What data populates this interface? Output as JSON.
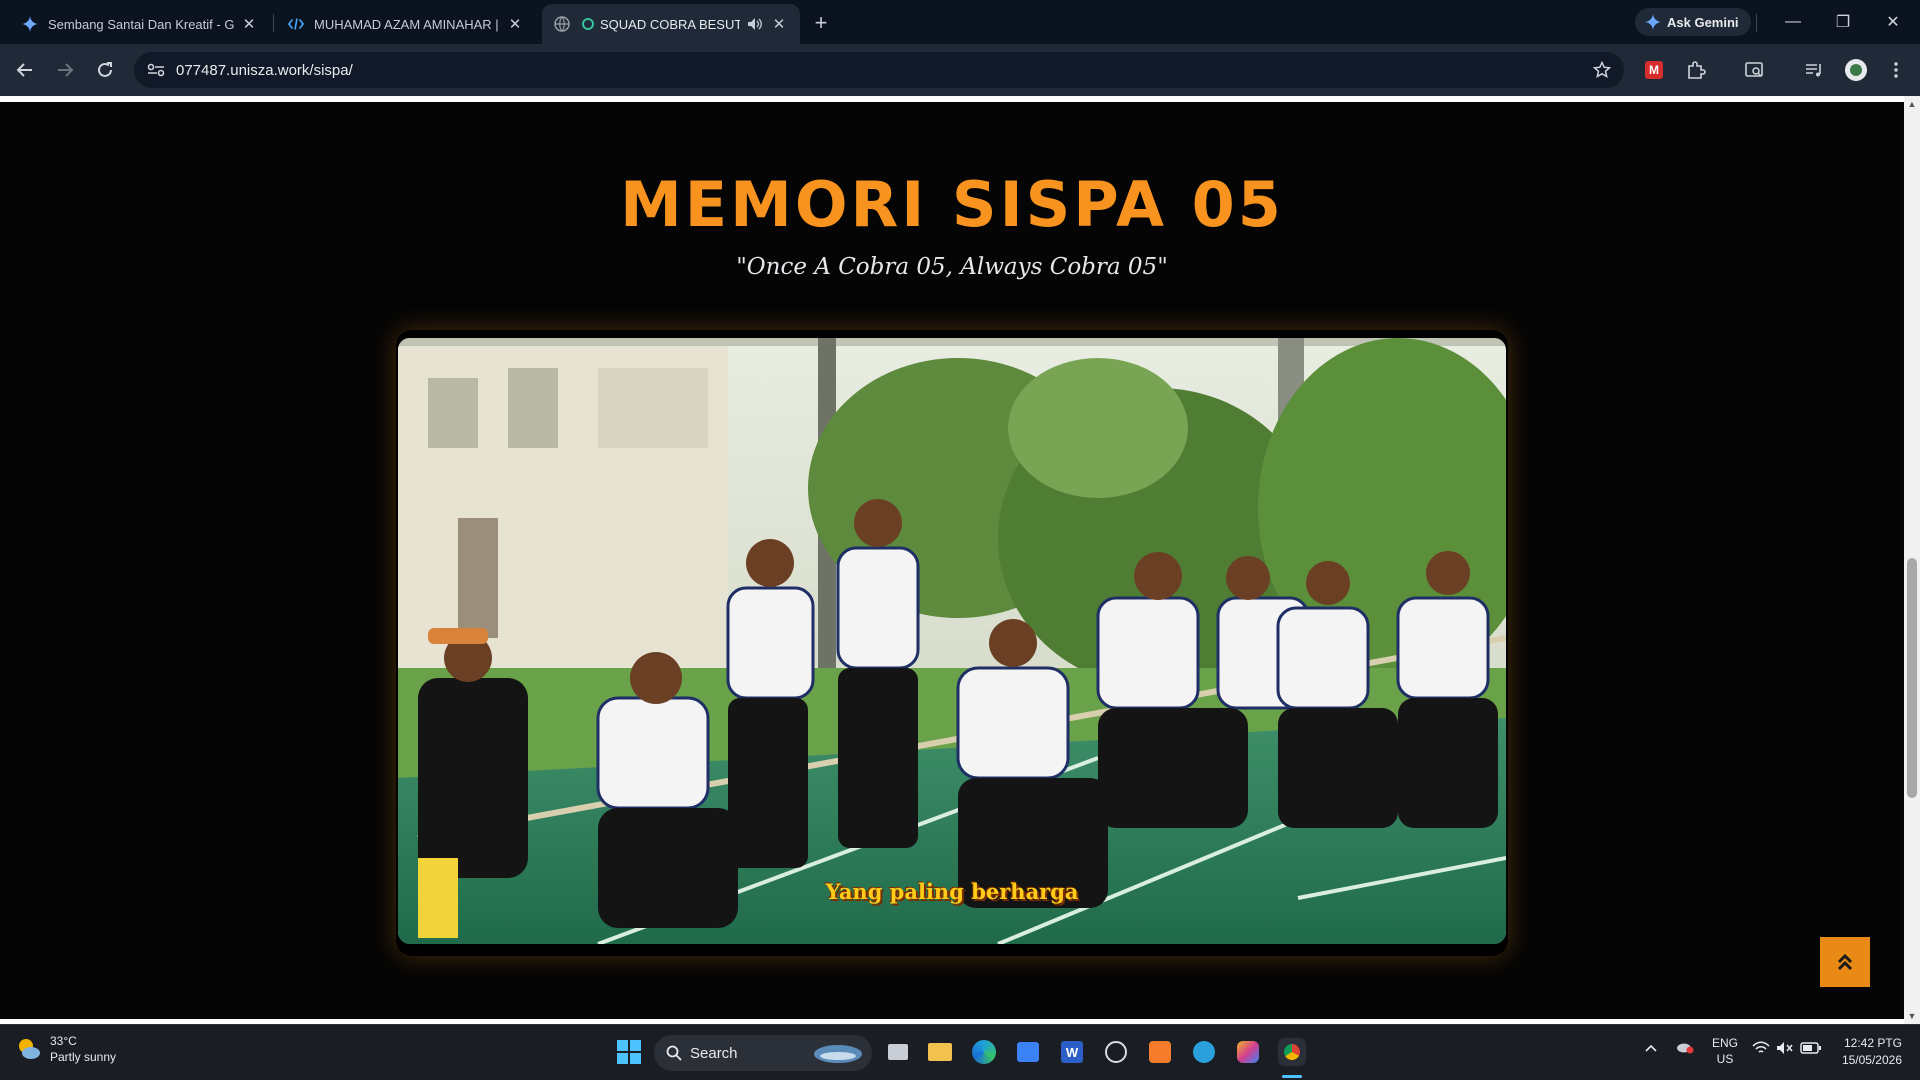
{
  "browser": {
    "tabs": [
      {
        "title": "Sembang Santai Dan Kreatif - Google",
        "icon": "gemini-icon"
      },
      {
        "title": "MUHAMAD AZAM AMINAHAR | e",
        "icon": "code-icon"
      },
      {
        "title": "SQUAD COBRA BESUT",
        "icon": "globe-icon",
        "active": true,
        "audio": true
      }
    ],
    "ask_gemini": "Ask Gemini",
    "url": "077487.unisza.work/sispa/"
  },
  "page": {
    "heading": "MEMORI SISPA 05",
    "subtitle": "\"Once A Cobra 05, Always Cobra 05\"",
    "video_caption": "Yang paling berharga",
    "accent_color": "#f7931e"
  },
  "taskbar": {
    "weather_temp": "33°C",
    "weather_desc": "Partly sunny",
    "search_label": "Search",
    "lang": "ENG",
    "region": "US",
    "time": "12:42 PTG",
    "date": "15/05/2026"
  }
}
